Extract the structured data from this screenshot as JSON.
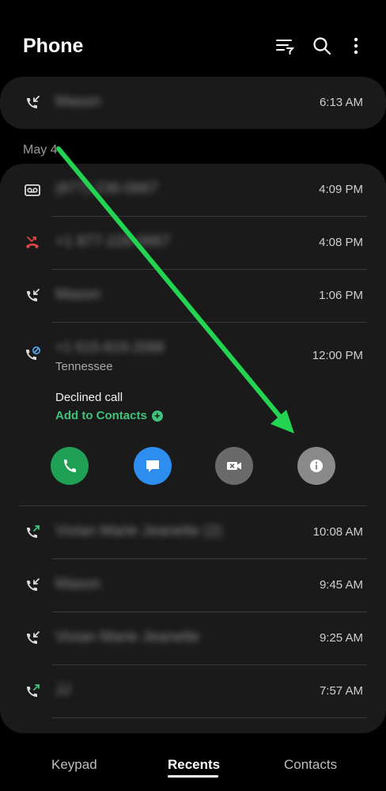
{
  "header": {
    "title": "Phone",
    "icons": [
      "filter-icon",
      "search-icon",
      "more-icon"
    ]
  },
  "top_card": {
    "row": {
      "icon": "incoming-call-icon",
      "name": "Mason",
      "time": "6:13 AM"
    }
  },
  "date_header": "May 4",
  "calls": [
    {
      "icon": "voicemail-icon",
      "name": "(877) 236-0667",
      "time": "4:09 PM"
    },
    {
      "icon": "missed-call-icon",
      "name": "+1 877-226-0667",
      "time": "4:08 PM",
      "icon_color": "#e04545"
    },
    {
      "icon": "incoming-call-icon",
      "name": "Mason",
      "time": "1:06 PM"
    }
  ],
  "expanded": {
    "icon": "declined-call-icon",
    "name": "+1 615-819-2088",
    "location": "Tennessee",
    "time": "12:00 PM",
    "status": "Declined call",
    "add_to_contacts": "Add to Contacts"
  },
  "actions": [
    {
      "name": "call-button",
      "icon": "phone-icon",
      "color": "#1fa055"
    },
    {
      "name": "message-button",
      "icon": "message-icon",
      "color": "#2e8ef0"
    },
    {
      "name": "video-call-button",
      "icon": "video-icon",
      "color": "#6a6a6a"
    },
    {
      "name": "info-button",
      "icon": "info-icon",
      "color": "#8a8a8a"
    }
  ],
  "calls_after": [
    {
      "icon": "outgoing-call-icon",
      "name": "Vivian Marie Jeanette (2)",
      "time": "10:08 AM"
    },
    {
      "icon": "incoming-call-icon",
      "name": "Mason",
      "time": "9:45 AM"
    },
    {
      "icon": "incoming-call-icon",
      "name": "Vivian Marie Jeanette",
      "time": "9:25 AM"
    },
    {
      "icon": "outgoing-call-icon",
      "name": "JJ",
      "time": "7:57 AM"
    }
  ],
  "bottom_nav": {
    "tabs": [
      "Keypad",
      "Recents",
      "Contacts"
    ],
    "active": "Recents"
  },
  "colors": {
    "accent_green": "#3ec37a",
    "arrow_green": "#22d451",
    "missed_red": "#e04545"
  }
}
